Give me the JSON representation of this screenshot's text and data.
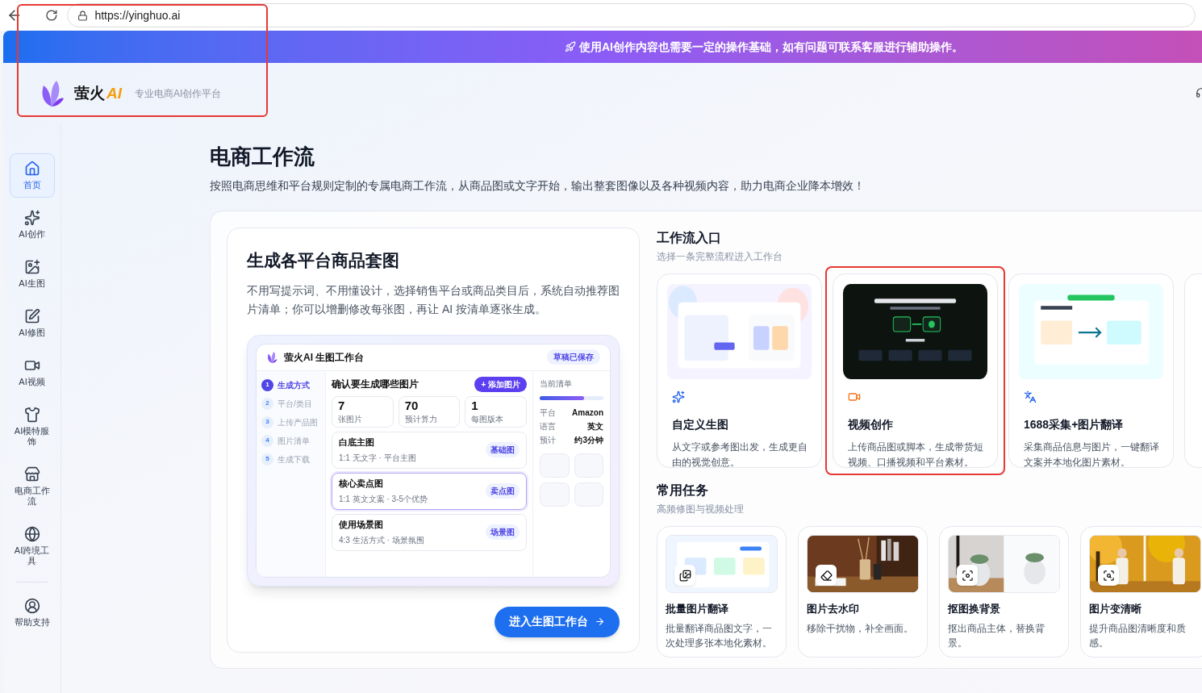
{
  "browser": {
    "url": "https://yinghuo.ai",
    "marked": true
  },
  "banner": {
    "text": "使用AI创作内容也需要一定的操作基础，如有问题可联系客服进行辅助操作。"
  },
  "brand": {
    "name": "萤火",
    "accent": "AI",
    "tagline": "专业电商AI创作平台"
  },
  "sidebar": {
    "items": [
      {
        "label": "首页",
        "selected": true
      },
      {
        "label": "AI创作",
        "selected": false
      },
      {
        "label": "AI生图",
        "selected": false
      },
      {
        "label": "AI修图",
        "selected": false
      },
      {
        "label": "AI视频",
        "selected": false
      },
      {
        "label": "AI模特服饰",
        "selected": false
      },
      {
        "label": "电商工作流",
        "selected": false
      },
      {
        "label": "AI跨境工具",
        "selected": false
      }
    ],
    "footer_items": [
      {
        "label": "帮助支持",
        "selected": false
      }
    ]
  },
  "page": {
    "title": "电商工作流",
    "description": "按照电商思维和平台规则定制的专属电商工作流，从商品图或文字开始，输出整套图像以及各种视频内容，助力电商企业降本增效！"
  },
  "feature": {
    "title": "生成各平台商品套图",
    "description": "不用写提示词、不用懂设计，选择销售平台或商品类目后，系统自动推荐图片清单；你可以增删修改每张图，再让 AI 按清单逐张生成。",
    "preview": {
      "title": "萤火AI 生图工作台",
      "status": "草稿已保存",
      "steps": [
        {
          "number": "1",
          "label": "生成方式",
          "selected": true
        },
        {
          "number": "2",
          "label": "平台/类目",
          "selected": false
        },
        {
          "number": "3",
          "label": "上传产品图",
          "selected": false
        },
        {
          "number": "4",
          "label": "图片清单",
          "selected": false
        },
        {
          "number": "5",
          "label": "生成下载",
          "selected": false
        }
      ],
      "heading": "确认要生成哪些图片",
      "add_button": "+ 添加图片",
      "stats": [
        {
          "value": "7",
          "label": "张图片"
        },
        {
          "value": "70",
          "label": "预计算力"
        },
        {
          "value": "1",
          "label": "每图版本"
        }
      ],
      "images": [
        {
          "title": "白底主图",
          "meta": "1:1 无文字 · 平台主图",
          "tag": "基础图",
          "selected": false
        },
        {
          "title": "核心卖点图",
          "meta": "1:1 英文文案 · 3-5个优势",
          "tag": "卖点图",
          "selected": true
        },
        {
          "title": "使用场景图",
          "meta": "4:3 生活方式 · 场景氛围",
          "tag": "场景图",
          "selected": false
        }
      ],
      "summary": {
        "title": "当前清单",
        "level": 0.7,
        "rows": [
          {
            "key": "平台",
            "value": "Amazon"
          },
          {
            "key": "语言",
            "value": "英文"
          },
          {
            "key": "预计",
            "value": "约3分钟"
          }
        ]
      }
    },
    "button": "进入生图工作台"
  },
  "workflows": {
    "title": "工作流入口",
    "subtitle": "选择一条完整流程进入工作台",
    "items": [
      {
        "kind": "light",
        "title": "自定义生图",
        "description": "从文字或参考图出发，生成更自由的视觉创意。",
        "marked": false
      },
      {
        "kind": "dark",
        "title": "视频创作",
        "description": "上传商品图或脚本，生成带货短视频、口播视频和平台素材。",
        "marked": true
      },
      {
        "kind": "flow",
        "title": "1688采集+图片翻译",
        "description": "采集商品信息与图片，一键翻译文案并本地化图片素材。",
        "marked": false
      }
    ]
  },
  "tasks": {
    "title": "常用任务",
    "subtitle": "高频修图与视频处理",
    "items": [
      {
        "kind": "ui",
        "title": "批量图片翻译",
        "description": "批量翻译商品图文字，一次处理多张本地化素材。"
      },
      {
        "kind": "shelf",
        "title": "图片去水印",
        "description": "移除干扰物，补全画面。"
      },
      {
        "kind": "plant",
        "title": "抠图换背景",
        "description": "抠出商品主体，替换背景。"
      },
      {
        "kind": "autumn",
        "title": "图片变清晰",
        "description": "提升商品图清晰度和质感。"
      }
    ]
  }
}
